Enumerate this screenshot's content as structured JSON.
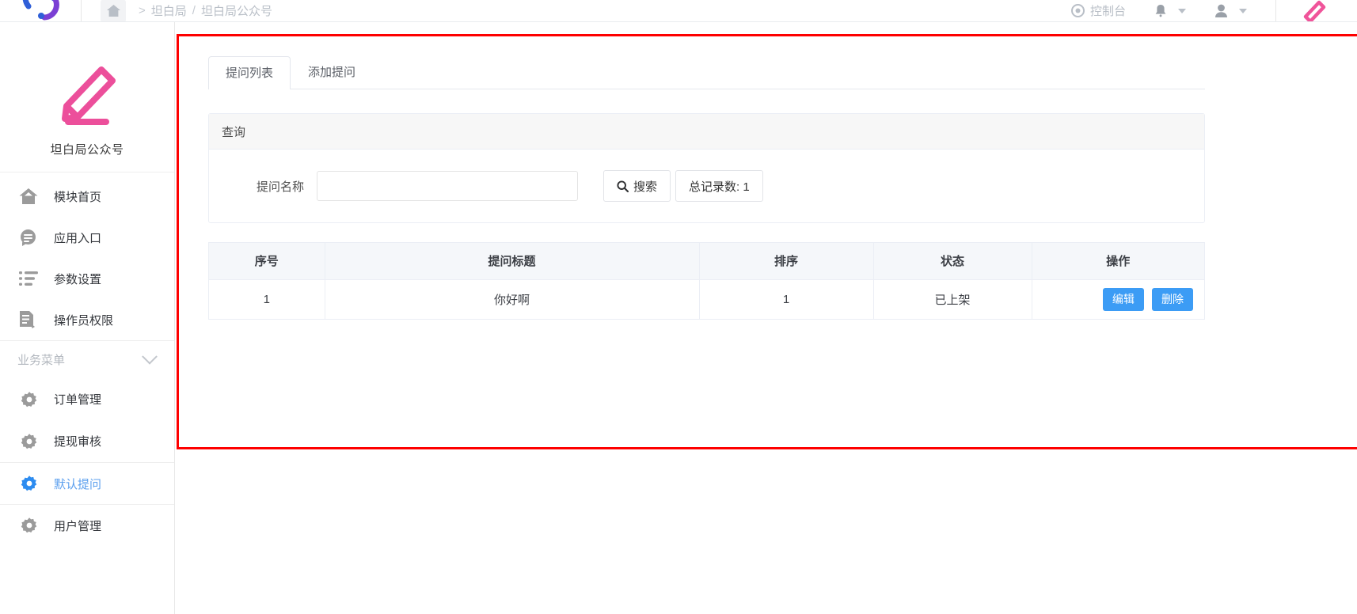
{
  "topbar": {
    "breadcrumb": {
      "home_icon": "home-icon",
      "separator": ">",
      "items": [
        "坦白局",
        "坦白局公众号"
      ],
      "joined": "> 坦白局 / 坦白局公众号"
    },
    "console_label": "控制台",
    "console_icon": "dashboard-icon",
    "bell_icon": "bell-icon",
    "user_icon": "user-icon",
    "pencil_icon": "pencil-icon"
  },
  "sidebar": {
    "brand_name": "坦白局公众号",
    "brand_icon": "pencil-icon",
    "items": [
      {
        "label": "模块首页",
        "icon": "home-icon"
      },
      {
        "label": "应用入口",
        "icon": "chat-bubble-icon"
      },
      {
        "label": "参数设置",
        "icon": "list-icon"
      },
      {
        "label": "操作员权限",
        "icon": "document-edit-icon"
      }
    ],
    "group": {
      "title": "业务菜单",
      "chevron_icon": "chevron-down-icon",
      "items": [
        {
          "label": "订单管理",
          "icon": "gear-icon",
          "active": false
        },
        {
          "label": "提现审核",
          "icon": "gear-icon",
          "active": false
        },
        {
          "label": "默认提问",
          "icon": "gear-icon",
          "active": true
        },
        {
          "label": "用户管理",
          "icon": "gear-icon",
          "active": false
        }
      ]
    },
    "active_color": "#5b9fee"
  },
  "main": {
    "tabs": [
      {
        "label": "提问列表",
        "active": true
      },
      {
        "label": "添加提问",
        "active": false
      }
    ],
    "query": {
      "title": "查询",
      "field_label": "提问名称",
      "field_value": "",
      "field_placeholder": "",
      "search_button": "搜索",
      "search_icon": "search-icon",
      "total_button": "总记录数: 1",
      "total_count": 1
    },
    "table": {
      "columns": [
        "序号",
        "提问标题",
        "排序",
        "状态",
        "操作"
      ],
      "rows": [
        {
          "序号": "1",
          "提问标题": "你好啊",
          "排序": "1",
          "状态": "已上架",
          "actions": [
            "编辑",
            "删除"
          ]
        }
      ]
    },
    "highlight_color": "#fe0000",
    "primary_color": "#3c9cf5"
  }
}
